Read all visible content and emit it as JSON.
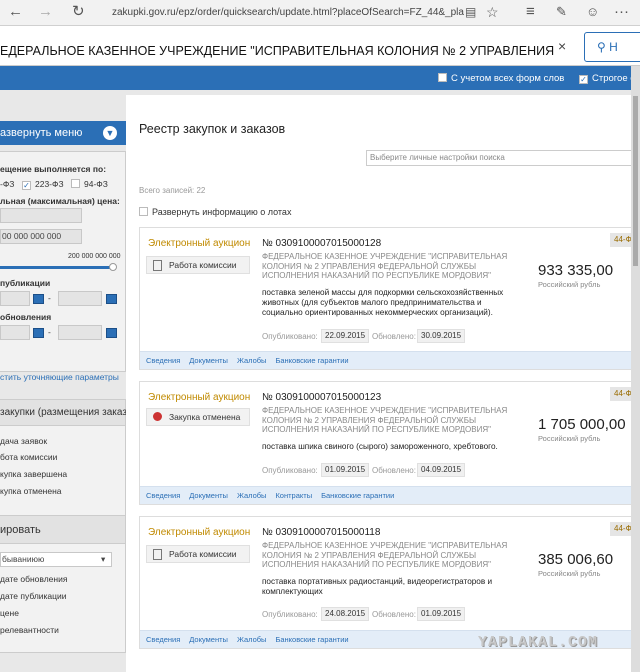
{
  "browser": {
    "url": "zakupki.gov.ru/epz/order/quicksearch/update.html?placeOfSearch=FZ_44&_placeOfSearc"
  },
  "search": {
    "query": "ЕДЕРАЛЬНОЕ КАЗЕННОЕ УЧРЕЖДЕНИЕ \"ИСПРАВИТЕЛЬНАЯ КОЛОНИЯ № 2 УПРАВЛЕНИЯ",
    "clear": "×",
    "button": "Н"
  },
  "bluebar": {
    "opt1": "С учетом всех форм слов",
    "opt2": "Строгое с"
  },
  "sidebar": {
    "expand": "азвернуть меню",
    "place_label": "ещение выполняется по:",
    "fz": [
      "-ФЗ",
      "223-ФЗ",
      "94-ФЗ"
    ],
    "price_label": "льная (максимальная) цена:",
    "price_value": "00 000 000 000",
    "range_max": "200 000 000 000",
    "pub_label": "публикации",
    "upd_label": "обновления",
    "dash": "-",
    "refine": "стить уточняющие параметры",
    "stage_title": "закупки (размещения заказа)",
    "stages": [
      "дача заявок",
      "бота комиссии",
      "купка завершена",
      "купка отменена"
    ],
    "sort_title": "ировать",
    "sort_select": "бываниюю",
    "sort_opts": [
      "дате обновления",
      "дате публикации",
      "цене",
      "релевантности"
    ]
  },
  "main": {
    "title": "Реестр закупок и заказов",
    "settings_placeholder": "Выберите личные настройки поиска",
    "total": "Всего записей: 22",
    "expand_lots": "Развернуть информацию о лотах"
  },
  "cards": [
    {
      "type": "Электронный аукцион",
      "number": "№ 0309100007015000128",
      "status": "Работа комиссии",
      "status_icon": "clipboard-icon",
      "org": "ФЕДЕРАЛЬНОЕ КАЗЕННОЕ УЧРЕЖДЕНИЕ \"ИСПРАВИТЕЛЬНАЯ КОЛОНИЯ № 2 УПРАВЛЕНИЯ ФЕДЕРАЛЬНОЙ СЛУЖБЫ ИСПОЛНЕНИЯ НАКАЗАНИЙ ПО РЕСПУБЛИКЕ МОРДОВИЯ\"",
      "desc": "поставка зеленой массы для подкормки сельскохозяйственных животных (для субъектов малого предпринимательства и социально ориентированных некоммерческих организаций).",
      "price": "933 335,00",
      "currency": "Российский рубль",
      "fz": "44-Ф",
      "pub_label": "Опубликовано:",
      "pub": "22.09.2015",
      "upd_label": "Обновлено:",
      "upd": "30.09.2015",
      "links": [
        "Сведения",
        "Документы",
        "Жалобы",
        "Банковские гарантии"
      ]
    },
    {
      "type": "Электронный аукцион",
      "number": "№ 0309100007015000123",
      "status": "Закупка отменена",
      "status_icon": "cancel-icon",
      "org": "ФЕДЕРАЛЬНОЕ КАЗЕННОЕ УЧРЕЖДЕНИЕ \"ИСПРАВИТЕЛЬНАЯ КОЛОНИЯ № 2 УПРАВЛЕНИЯ ФЕДЕРАЛЬНОЙ СЛУЖБЫ ИСПОЛНЕНИЯ НАКАЗАНИЙ ПО РЕСПУБЛИКЕ МОРДОВИЯ\"",
      "desc": "поставка шпика свиного (сырого) замороженного, хребтового.",
      "price": "1 705 000,00",
      "currency": "Российский рубль",
      "fz": "44-Ф",
      "pub_label": "Опубликовано:",
      "pub": "01.09.2015",
      "upd_label": "Обновлено:",
      "upd": "04.09.2015",
      "links": [
        "Сведения",
        "Документы",
        "Жалобы",
        "Контракты",
        "Банковские гарантии"
      ]
    },
    {
      "type": "Электронный аукцион",
      "number": "№ 0309100007015000118",
      "status": "Работа комиссии",
      "status_icon": "clipboard-icon",
      "org": "ФЕДЕРАЛЬНОЕ КАЗЕННОЕ УЧРЕЖДЕНИЕ \"ИСПРАВИТЕЛЬНАЯ КОЛОНИЯ № 2 УПРАВЛЕНИЯ ФЕДЕРАЛЬНОЙ СЛУЖБЫ ИСПОЛНЕНИЯ НАКАЗАНИЙ ПО РЕСПУБЛИКЕ МОРДОВИЯ\"",
      "desc": "поставка портативных радиостанций, видеорегистраторов и комплектующих",
      "price": "385 006,60",
      "currency": "Российский рубль",
      "fz": "44-Ф",
      "pub_label": "Опубликовано:",
      "pub": "24.08.2015",
      "upd_label": "Обновлено:",
      "upd": "01.09.2015",
      "links": [
        "Сведения",
        "Документы",
        "Жалобы",
        "Банковские гарантии"
      ]
    }
  ],
  "watermark": "YAPLAKAL.COM",
  "colors": {
    "accent": "#2b6fb6",
    "auction": "#c08a00"
  }
}
